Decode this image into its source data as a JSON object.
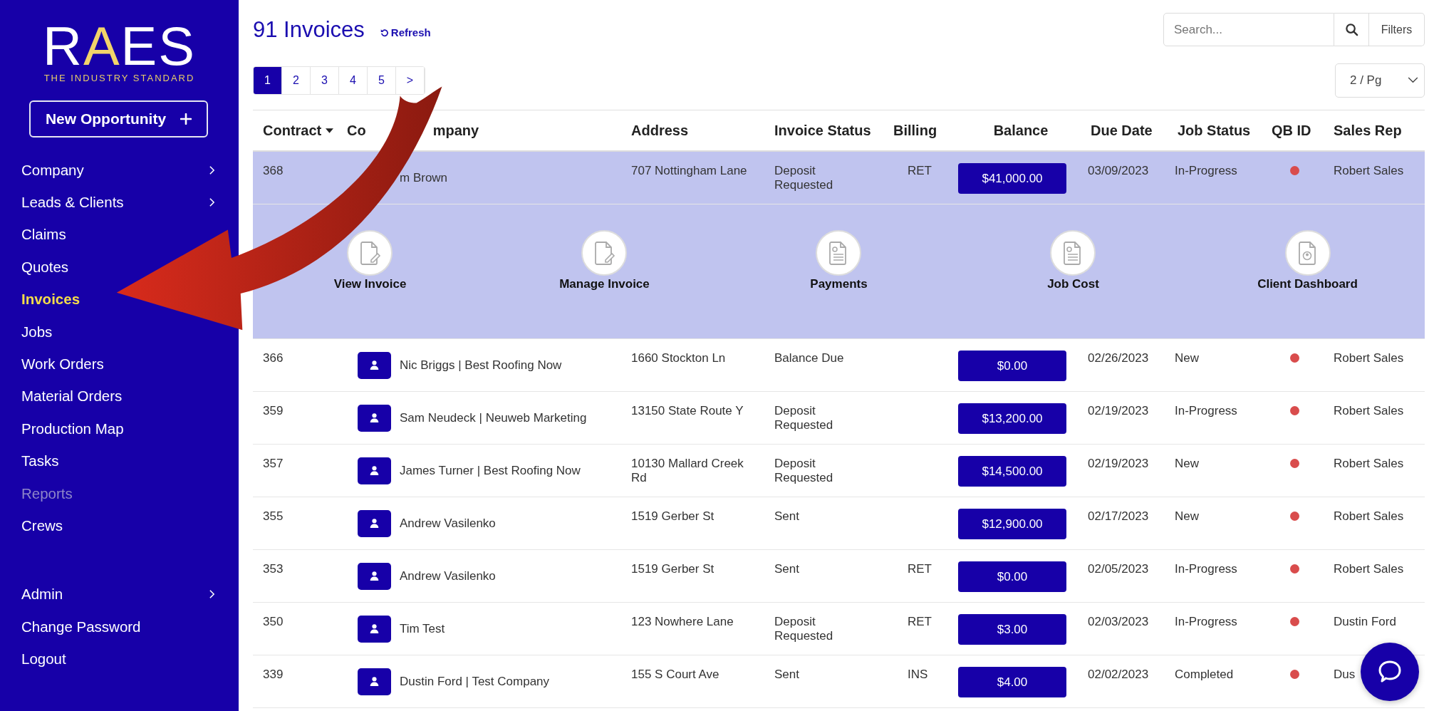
{
  "sidebar": {
    "logo": "RAES",
    "tagline": "THE INDUSTRY STANDARD",
    "new_button": "New Opportunity",
    "items": [
      {
        "label": "Company",
        "submenu": true,
        "selected": false,
        "disabled": false
      },
      {
        "label": "Leads & Clients",
        "submenu": true,
        "selected": false,
        "disabled": false
      },
      {
        "label": "Claims",
        "submenu": false,
        "selected": false,
        "disabled": false
      },
      {
        "label": "Quotes",
        "submenu": false,
        "selected": false,
        "disabled": false
      },
      {
        "label": "Invoices",
        "submenu": false,
        "selected": true,
        "disabled": false
      },
      {
        "label": "Jobs",
        "submenu": false,
        "selected": false,
        "disabled": false
      },
      {
        "label": "Work Orders",
        "submenu": false,
        "selected": false,
        "disabled": false
      },
      {
        "label": "Material Orders",
        "submenu": false,
        "selected": false,
        "disabled": false
      },
      {
        "label": "Production Map",
        "submenu": false,
        "selected": false,
        "disabled": false
      },
      {
        "label": "Tasks",
        "submenu": false,
        "selected": false,
        "disabled": false
      },
      {
        "label": "Reports",
        "submenu": false,
        "selected": false,
        "disabled": true
      },
      {
        "label": "Crews",
        "submenu": false,
        "selected": false,
        "disabled": false
      }
    ],
    "bottom_items": [
      {
        "label": "Admin",
        "submenu": true
      },
      {
        "label": "Change Password",
        "submenu": false
      },
      {
        "label": "Logout",
        "submenu": false
      }
    ]
  },
  "header": {
    "title": "91 Invoices",
    "refresh": "Refresh",
    "search": {
      "placeholder": "Search..."
    },
    "filters": "Filters",
    "per_page": "2 / Pg"
  },
  "pagination": [
    {
      "label": "1",
      "selected": true
    },
    {
      "label": "2",
      "selected": false
    },
    {
      "label": "3",
      "selected": false
    },
    {
      "label": "4",
      "selected": false
    },
    {
      "label": "5",
      "selected": false
    },
    {
      "label": ">",
      "selected": false
    }
  ],
  "table": {
    "columns": [
      {
        "parts": [
          "Contract"
        ],
        "sorted": true
      },
      {
        "parts": [
          "Co",
          "mpany"
        ],
        "sorted": false
      },
      {
        "parts": [
          "Address"
        ],
        "sorted": false
      },
      {
        "parts": [
          "Invoice Status"
        ],
        "sorted": false
      },
      {
        "parts": [
          "Billing"
        ],
        "sorted": false
      },
      {
        "parts": [
          "Balance"
        ],
        "sorted": false
      },
      {
        "parts": [
          "Due Date"
        ],
        "sorted": false
      },
      {
        "parts": [
          "Job Status"
        ],
        "sorted": false
      },
      {
        "parts": [
          "QB ID"
        ],
        "sorted": false
      },
      {
        "parts": [
          "Sales Rep"
        ],
        "sorted": false
      }
    ],
    "rows": [
      {
        "contract": "368",
        "avatar": false,
        "client": "m Brown",
        "address": "707 Nottingham Lane",
        "invoice_status": "Deposit Requested",
        "billing": "RET",
        "balance": "$41,000.00",
        "due_date": "03/09/2023",
        "job_status": "In-Progress",
        "qb_synced": false,
        "sales_rep": "Robert Sales",
        "selected": true,
        "expanded": true,
        "actions": [
          "View Invoice",
          "Manage Invoice",
          "Payments",
          "Job Cost",
          "Client Dashboard"
        ]
      },
      {
        "contract": "366",
        "avatar": true,
        "client": "Nic Briggs | Best Roofing Now",
        "address": "1660 Stockton Ln",
        "invoice_status": "Balance Due",
        "balance": "$0.00",
        "due_date": "02/26/2023",
        "job_status": "New",
        "qb_synced": false,
        "sales_rep": "Robert Sales",
        "selected": false,
        "expanded": false
      },
      {
        "contract": "359",
        "avatar": true,
        "client": "Sam Neudeck | Neuweb Marketing",
        "address": "13150 State Route Y",
        "invoice_status": "Deposit Requested",
        "balance": "$13,200.00",
        "due_date": "02/19/2023",
        "job_status": "In-Progress",
        "qb_synced": false,
        "sales_rep": "Robert Sales",
        "selected": false,
        "expanded": false
      },
      {
        "contract": "357",
        "avatar": true,
        "client": "James Turner | Best Roofing Now",
        "address": "10130 Mallard Creek Rd",
        "invoice_status": "Deposit Requested",
        "balance": "$14,500.00",
        "due_date": "02/19/2023",
        "job_status": "New",
        "qb_synced": false,
        "sales_rep": "Robert Sales",
        "selected": false,
        "expanded": false
      },
      {
        "contract": "355",
        "avatar": true,
        "client": "Andrew Vasilenko",
        "address": "1519 Gerber St",
        "invoice_status": "Sent",
        "balance": "$12,900.00",
        "due_date": "02/17/2023",
        "job_status": "New",
        "qb_synced": false,
        "sales_rep": "Robert Sales",
        "selected": false,
        "expanded": false
      },
      {
        "contract": "353",
        "avatar": true,
        "client": "Andrew Vasilenko",
        "address": "1519 Gerber St",
        "invoice_status": "Sent",
        "billing": "RET",
        "balance": "$0.00",
        "due_date": "02/05/2023",
        "job_status": "In-Progress",
        "qb_synced": false,
        "sales_rep": "Robert Sales",
        "selected": false,
        "expanded": false
      },
      {
        "contract": "350",
        "avatar": true,
        "client": "Tim Test",
        "address": "123 Nowhere Lane",
        "invoice_status": "Deposit Requested",
        "billing": "RET",
        "balance": "$3.00",
        "due_date": "02/03/2023",
        "job_status": "In-Progress",
        "qb_synced": false,
        "sales_rep": "Dustin Ford",
        "selected": false,
        "expanded": false
      },
      {
        "contract": "339",
        "avatar": true,
        "client": "Dustin Ford | Test Company",
        "address": "155 S Court Ave",
        "invoice_status": "Sent",
        "billing": "INS",
        "balance": "$4.00",
        "due_date": "02/02/2023",
        "job_status": "Completed",
        "qb_synced": false,
        "sales_rep": "Dus",
        "selected": false,
        "expanded": false
      }
    ]
  }
}
